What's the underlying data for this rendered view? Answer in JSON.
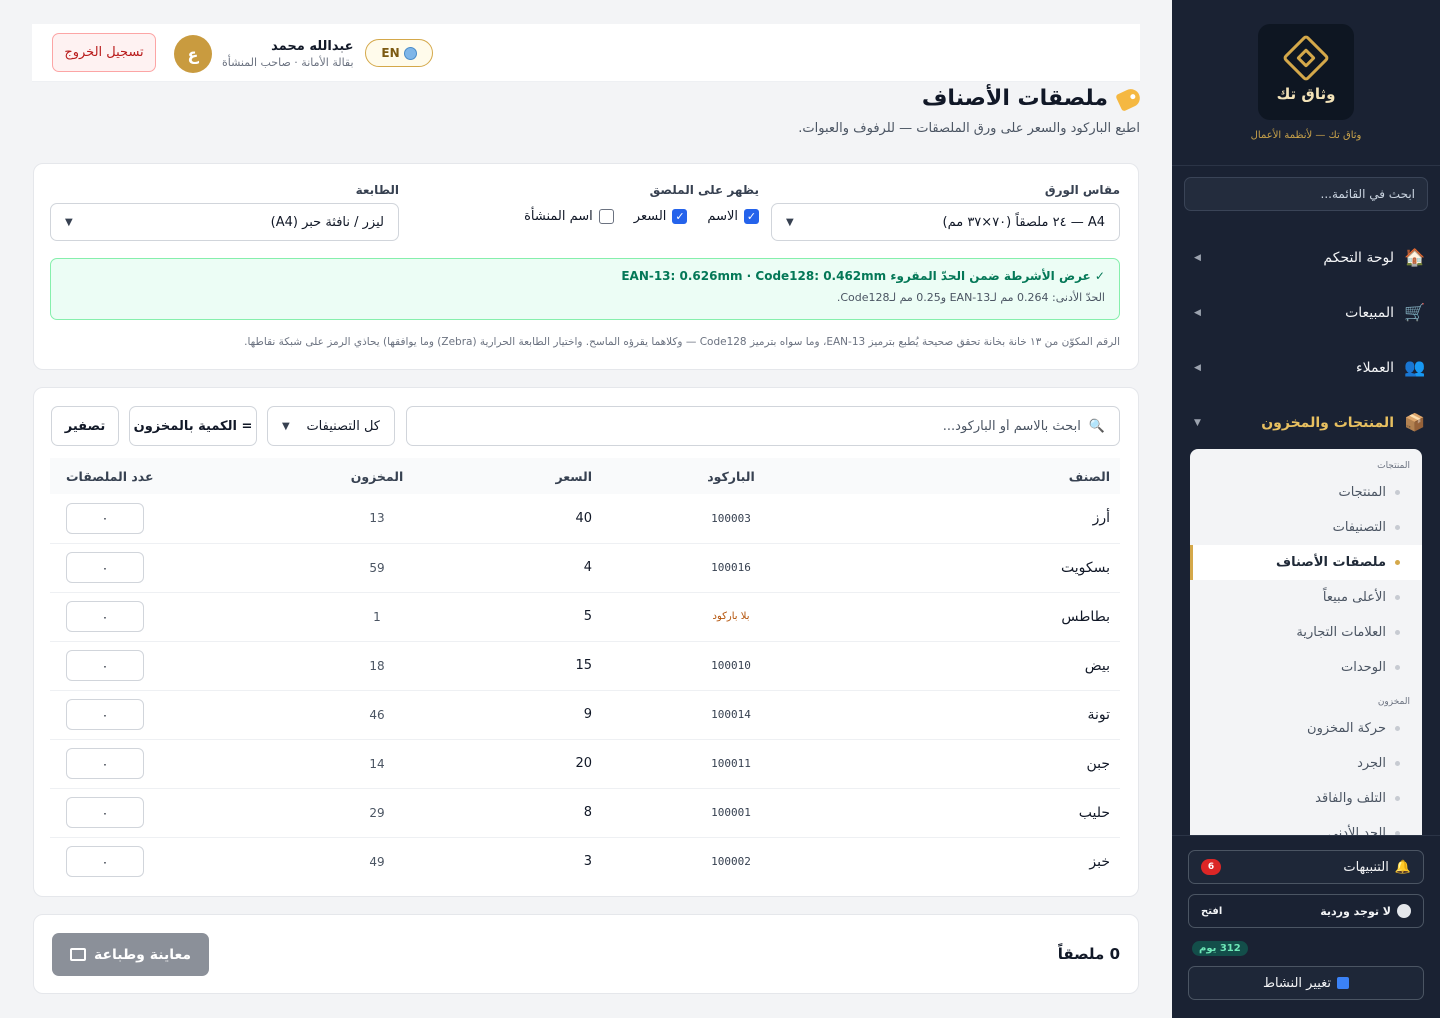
{
  "sidebar": {
    "brand_name": "وثاق تك",
    "brand_tagline": "وثاق تك — لأنظمة الأعمال",
    "search_placeholder": "ابحث في القائمة...",
    "nav": [
      {
        "label": "لوحة التحكم",
        "icon": "house-icon"
      },
      {
        "label": "المبيعات",
        "icon": "cart-icon"
      },
      {
        "label": "العملاء",
        "icon": "users-icon"
      },
      {
        "label": "المنتجات والمخزون",
        "icon": "box-icon"
      }
    ],
    "submenu": {
      "group_products": "المنتجات",
      "group_inventory": "المخزون",
      "items": [
        "المنتجات",
        "التصنيفات",
        "ملصقات الأصناف",
        "الأعلى مبيعاً",
        "العلامات التجارية",
        "الوحدات",
        "حركة المخزون",
        "الجرد",
        "التلف والفاقد",
        "الحد الأدنى"
      ]
    },
    "alerts_label": "التنبيهات",
    "alerts_count": "6",
    "shift_status": "لا توجد وردية",
    "shift_open": "افتح",
    "days_left": "312 يوم",
    "change_activity": "تغيير النشاط"
  },
  "topbar": {
    "logout": "تسجيل الخروج",
    "user_name": "عبدالله محمد",
    "user_role": "بقالة الأمانة · صاحب المنشأة",
    "avatar_letter": "ع",
    "lang": "EN"
  },
  "page": {
    "title": "ملصقات الأصناف",
    "subtitle": "اطبع الباركود والسعر على ورق الملصقات — للرفوف والعبوات."
  },
  "settings": {
    "paper_label": "مقاس الورق",
    "paper_value": "A4 — ٢٤ ملصقاً (٧٠×٣٧ مم)",
    "show_label": "يظهر على الملصق",
    "check_name": "الاسم",
    "check_price": "السعر",
    "check_store": "اسم المنشأة",
    "printer_label": "الطابعة",
    "printer_value": "ليزر / نافثة حبر (A4)",
    "notice_title": "✓ عرض الأشرطة ضمن الحدّ المقروء EAN-13: 0.626mm · Code128: 0.462mm",
    "notice_detail": "الحدّ الأدنى: 0.264 مم لـEAN-13 و0.25 مم لـCode128.",
    "hint": "الرقم المكوّن من ١٣ خانة بخانة تحقق صحيحة يُطبع بترميز EAN-13، وما سواه بترميز Code128 — وكلاهما يقرؤه الماسح. واختيار الطابعة الحرارية (Zebra) وما يوافقها) يحاذي الرمز على شبكة نقاطها."
  },
  "filters": {
    "search_placeholder": "ابحث بالاسم أو الباركود...",
    "category": "كل التصنيفات",
    "qty_stock": "= الكمية بالمخزون",
    "reset": "تصفير"
  },
  "table": {
    "headers": {
      "name": "الصنف",
      "barcode": "الباركود",
      "price": "السعر",
      "stock": "المخزون",
      "labels": "عدد الملصقات"
    },
    "rows": [
      {
        "name": "أرز",
        "barcode": "100003",
        "price": "40",
        "stock": "13",
        "qty": "٠"
      },
      {
        "name": "بسكويت",
        "barcode": "100016",
        "price": "4",
        "stock": "59",
        "qty": "٠"
      },
      {
        "name": "بطاطس",
        "barcode": "بلا باركود",
        "price": "5",
        "stock": "1",
        "qty": "٠"
      },
      {
        "name": "بيض",
        "barcode": "100010",
        "price": "15",
        "stock": "18",
        "qty": "٠"
      },
      {
        "name": "تونة",
        "barcode": "100014",
        "price": "9",
        "stock": "46",
        "qty": "٠"
      },
      {
        "name": "جبن",
        "barcode": "100011",
        "price": "20",
        "stock": "14",
        "qty": "٠"
      },
      {
        "name": "حليب",
        "barcode": "100001",
        "price": "8",
        "stock": "29",
        "qty": "٠"
      },
      {
        "name": "خبز",
        "barcode": "100002",
        "price": "3",
        "stock": "49",
        "qty": "٠"
      }
    ]
  },
  "footer": {
    "count": "0 ملصقاً",
    "print": "معاينة وطباعة"
  }
}
